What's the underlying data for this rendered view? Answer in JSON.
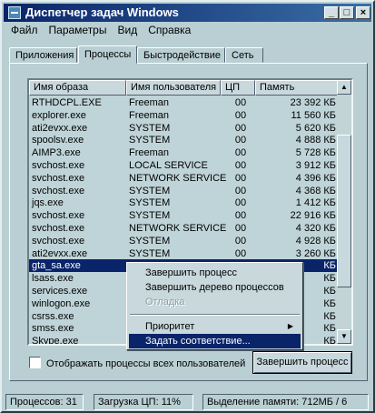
{
  "window": {
    "title": "Диспетчер задач Windows",
    "min_glyph": "_",
    "max_glyph": "□",
    "close_glyph": "×"
  },
  "menu": [
    "Файл",
    "Параметры",
    "Вид",
    "Справка"
  ],
  "tabs": [
    "Приложения",
    "Процессы",
    "Быстродействие",
    "Сеть"
  ],
  "table": {
    "columns": [
      "Имя образа",
      "Имя пользователя",
      "ЦП",
      "Память"
    ],
    "rows": [
      [
        "RTHDCPL.EXE",
        "Freeman",
        "00",
        "23 392 КБ"
      ],
      [
        "explorer.exe",
        "Freeman",
        "00",
        "11 560 КБ"
      ],
      [
        "ati2evxx.exe",
        "SYSTEM",
        "00",
        "5 620 КБ"
      ],
      [
        "spoolsv.exe",
        "SYSTEM",
        "00",
        "4 888 КБ"
      ],
      [
        "AIMP3.exe",
        "Freeman",
        "00",
        "5 728 КБ"
      ],
      [
        "svchost.exe",
        "LOCAL SERVICE",
        "00",
        "3 912 КБ"
      ],
      [
        "svchost.exe",
        "NETWORK SERVICE",
        "00",
        "4 396 КБ"
      ],
      [
        "svchost.exe",
        "SYSTEM",
        "00",
        "4 368 КБ"
      ],
      [
        "jqs.exe",
        "SYSTEM",
        "00",
        "1 412 КБ"
      ],
      [
        "svchost.exe",
        "SYSTEM",
        "00",
        "22 916 КБ"
      ],
      [
        "svchost.exe",
        "NETWORK SERVICE",
        "00",
        "4 320 КБ"
      ],
      [
        "svchost.exe",
        "SYSTEM",
        "00",
        "4 928 КБ"
      ],
      [
        "ati2evxx.exe",
        "SYSTEM",
        "00",
        "3 260 КБ"
      ],
      [
        "gta_sa.exe",
        "",
        "",
        "КБ"
      ],
      [
        "lsass.exe",
        "",
        "",
        "КБ"
      ],
      [
        "services.exe",
        "",
        "",
        "КБ"
      ],
      [
        "winlogon.exe",
        "",
        "",
        "КБ"
      ],
      [
        "csrss.exe",
        "",
        "",
        "КБ"
      ],
      [
        "smss.exe",
        "",
        "",
        "КБ"
      ],
      [
        "Skype.exe",
        "",
        "",
        "КБ"
      ]
    ],
    "selected_row": 13
  },
  "context_menu": {
    "items": [
      "Завершить процесс",
      "Завершить дерево процессов",
      "Отладка",
      "Приоритет",
      "Задать соответствие..."
    ]
  },
  "show_all_users_label": "Отображать процессы всех пользователей",
  "end_process_button": "Завершить процесс",
  "statusbar": {
    "processes": "Процессов: 31",
    "cpu": "Загрузка ЦП: 11%",
    "memory": "Выделение памяти: 712МБ / 6"
  },
  "colors": {
    "selection": "#0a246a",
    "title_gradient_start": "#0a246a",
    "title_gradient_end": "#3a6ea5",
    "window_face": "#b9cfd3"
  }
}
